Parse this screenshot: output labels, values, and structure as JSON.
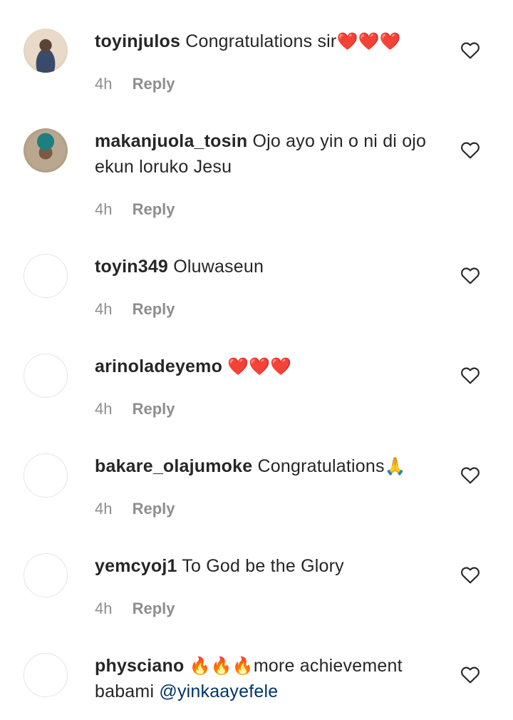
{
  "comments": [
    {
      "username": "toyinjulos",
      "text": "Congratulations sir",
      "emoji": "❤️❤️❤️",
      "time": "4h",
      "reply_label": "Reply",
      "avatar": "profile-photo"
    },
    {
      "username": "makanjuola_tosin",
      "text": "Ojo ayo yin o ni di ojo ekun loruko Jesu",
      "time": "4h",
      "reply_label": "Reply",
      "avatar": "profile-photo"
    },
    {
      "username": "toyin349",
      "text": "Oluwaseun",
      "time": "4h",
      "reply_label": "Reply",
      "avatar": "empty"
    },
    {
      "username": "arinoladeyemo",
      "text": "",
      "emoji": "❤️❤️❤️",
      "time": "4h",
      "reply_label": "Reply",
      "avatar": "empty"
    },
    {
      "username": "bakare_olajumoke",
      "text": "Congratulations",
      "emoji": "🙏",
      "time": "4h",
      "reply_label": "Reply",
      "avatar": "empty"
    },
    {
      "username": "yemcyoj1",
      "text": "To God be the Glory",
      "time": "4h",
      "reply_label": "Reply",
      "avatar": "empty"
    },
    {
      "username": "physciano",
      "emoji": "🔥🔥🔥",
      "text": "more achievement babami",
      "mention": "@yinkaayefele",
      "avatar": "empty"
    }
  ],
  "icons": {
    "like": "heart-outline-icon"
  },
  "colors": {
    "text": "#262626",
    "secondary": "#8e8e8e",
    "mention": "#003569",
    "avatar_border": "#e4e4e4"
  }
}
